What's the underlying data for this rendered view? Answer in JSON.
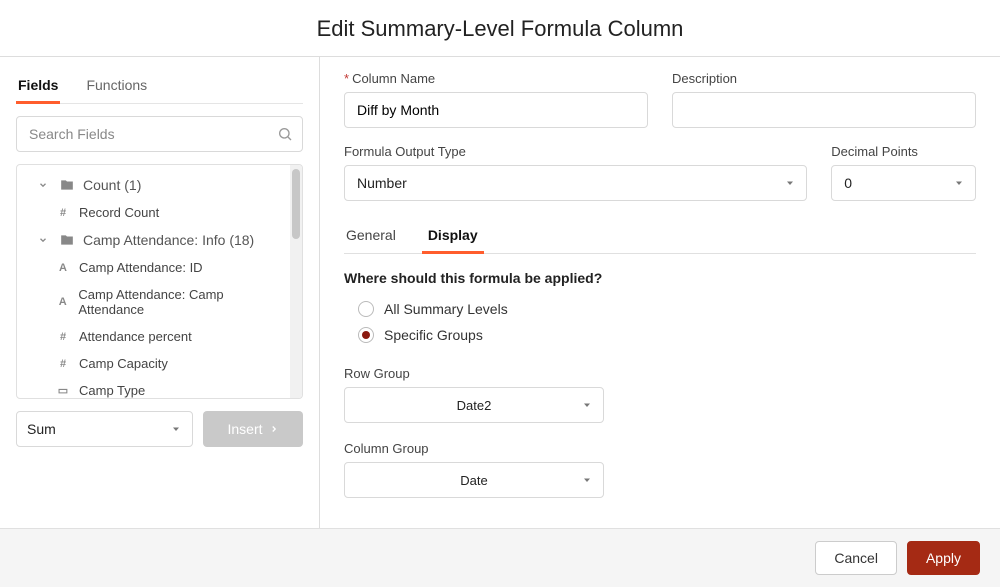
{
  "header": {
    "title": "Edit Summary-Level Formula Column"
  },
  "left": {
    "tabs": {
      "fields": "Fields",
      "functions": "Functions"
    },
    "search_placeholder": "Search Fields",
    "groups": [
      {
        "label": "Count (1)",
        "items": [
          {
            "type": "#",
            "label": "Record Count"
          }
        ]
      },
      {
        "label": "Camp Attendance: Info (18)",
        "items": [
          {
            "type": "A",
            "label": "Camp Attendance: ID"
          },
          {
            "type": "A",
            "label": "Camp Attendance: Camp Attendance"
          },
          {
            "type": "#",
            "label": "Attendance percent"
          },
          {
            "type": "#",
            "label": "Camp Capacity"
          },
          {
            "type": "▭",
            "label": "Camp Type"
          }
        ]
      }
    ],
    "agg_selected": "Sum",
    "insert_label": "Insert"
  },
  "form": {
    "column_name_label": "Column Name",
    "column_name_value": "Diff by Month",
    "description_label": "Description",
    "description_value": "",
    "output_type_label": "Formula Output Type",
    "output_type_value": "Number",
    "decimal_label": "Decimal Points",
    "decimal_value": "0"
  },
  "right_tabs": {
    "general": "General",
    "display": "Display"
  },
  "display": {
    "question": "Where should this formula be applied?",
    "opt_all": "All Summary Levels",
    "opt_specific": "Specific Groups",
    "row_group_label": "Row Group",
    "row_group_value": "Date2",
    "column_group_label": "Column Group",
    "column_group_value": "Date"
  },
  "footer": {
    "cancel": "Cancel",
    "apply": "Apply"
  }
}
